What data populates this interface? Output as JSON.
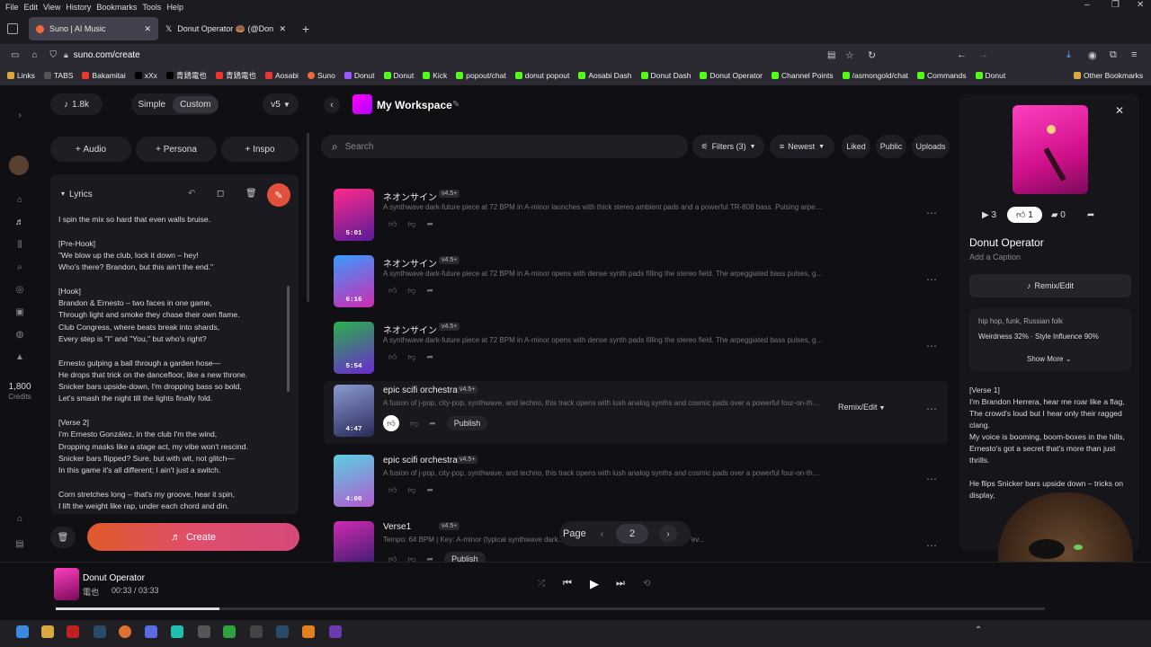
{
  "menubar": [
    "File",
    "Edit",
    "View",
    "History",
    "Bookmarks",
    "Tools",
    "Help"
  ],
  "tabs": [
    {
      "label": "Suno | AI Music",
      "active": true
    },
    {
      "label": "Donut Operator 🍩 (@DonutO…",
      "active": false
    }
  ],
  "url": "suno.com/create",
  "bookmarks": [
    "Links",
    "TABS",
    "Bakamitai",
    "xXx",
    "青鶏電也",
    "青鶏電也",
    "Aosabi",
    "Suno",
    "Donut",
    "Donut",
    "Kick",
    "popout/chat",
    "donut popout",
    "Aosabi Dash",
    "Donut Dash",
    "Donut Operator",
    "Channel Points",
    "/asmongold/chat",
    "Commands",
    "Donut"
  ],
  "other_bookmarks": "Other Bookmarks",
  "credits": {
    "value": "1,800",
    "label": "Credits"
  },
  "create": {
    "note_count": "1.8k",
    "mode_simple": "Simple",
    "mode_custom": "Custom",
    "version": "v5",
    "audio_btn": "Audio",
    "persona_btn": "Persona",
    "inspo_btn": "Inspo",
    "lyrics_label": "Lyrics",
    "lyrics_text": "I spin the mix so hard that even walls bruise.\n\n[Pre-Hook]\n\"We blow up the club, lock it down – hey!\nWho's there? Brandon, but this ain't the end.\"\n\n[Hook]\nBrandon & Ernesto – two faces in one game,\nThrough light and smoke they chase their own flame.\nClub Congress, where beats break into shards,\nEvery step is \"I\" and \"You,\" but who's right?\n\nErnesto gulping a ball through a garden hose—\nHe drops that trick on the dancefloor, like a new throne.\nSnicker bars upside-down, I'm dropping bass so bold,\nLet's smash the night till the lights finally fold.\n\n[Verse 2]\nI'm Ernesto González, in the club I'm the wind,\nDropping masks like a stage act, my vibe won't rescind.\nSnicker bars flipped? Sure, but with wit, not glitch—\nIn this game it's all different; I ain't just a switch.\n\nCorn stretches long – that's my groove, hear it spin,\nI lift the weight like rap, under each chord and din.",
    "create_btn": "Create"
  },
  "workspace": {
    "title": "My Workspace",
    "search_placeholder": "Search",
    "filters": "Filters (3)",
    "sort": "Newest",
    "liked": "Liked",
    "public": "Public",
    "uploads": "Uploads"
  },
  "songs": [
    {
      "title": "ネオンサイン",
      "version": "v4.5+",
      "desc": "A synthwave dark-future piece at 72 BPM in A-minor launches with thick stereo ambient pads and a powerful TR-808 bass. Pulsing arpeggiated...",
      "duration": "5:01",
      "colors": [
        "#ff2a8a",
        "#5a1a9a"
      ]
    },
    {
      "title": "ネオンサイン",
      "version": "v4.5+",
      "desc": "A synthwave dark-future piece at 72 BPM in A-minor opens with dense synth pads filling the stereo field. The arpeggiated bass pulses, giving for...",
      "duration": "6:16",
      "colors": [
        "#3a9aff",
        "#d02ab0"
      ]
    },
    {
      "title": "ネオンサイン",
      "version": "v4.5+",
      "desc": "A synthwave dark-future piece at 72 BPM in A-minor opens with dense synth pads filling the stereo field. The arpeggiated bass pulses, giving for...",
      "duration": "5:54",
      "colors": [
        "#2ab04a",
        "#6a2ad0"
      ]
    },
    {
      "title": "epic scifi orchestra",
      "version": "v4.5+",
      "desc": "A fusion of j-pop, city-pop, synthwave, and techno, this track opens with lush analog synths and cosmic pads over a powerful four-on-the-floor b...",
      "duration": "4:47",
      "colors": [
        "#8a9ad0",
        "#2a2a5a"
      ],
      "publish": "Publish",
      "remix": "Remix/Edit"
    },
    {
      "title": "epic scifi orchestra",
      "version": "v4.5+",
      "desc": "A fusion of j-pop, city-pop, synthwave, and techno, this track opens with lush analog synths and cosmic pads over a powerful four-on-the-floor b...",
      "duration": "4:00",
      "colors": [
        "#5ad0e0",
        "#b05ad0"
      ]
    },
    {
      "title": "Verse1",
      "version": "v4.5+",
      "desc": "Tempo: 64 BPM | Key: A-minor (typical synthwave dark... echoing leads. Let the music paint the \"ev...",
      "duration": "",
      "colors": [
        "#d02ab0",
        "#2a1a6a"
      ],
      "publish": "Publish"
    }
  ],
  "pager": {
    "label": "Page",
    "current": "2"
  },
  "detail": {
    "plays": "3",
    "likes": "1",
    "comments": "0",
    "title": "Donut Operator",
    "caption": "Add a Caption",
    "remix": "Remix/Edit",
    "tags": "hip hop, funk, Russian folk",
    "weirdness": "Weirdness 32% · Style Influence 90%",
    "show_more": "Show More",
    "lyrics": "[Verse 1]\nI'm Brandon Herrera, hear me roar like a flag,\nThe crowd's loud but I hear only their ragged clang.\nMy voice is booming, boom-boxes in the hills,\nErnesto's got a secret that's more than just thrills.\n\nHe flips Snicker bars upside down – tricks on display,"
  },
  "player": {
    "title": "Donut Operator",
    "artist": "電也",
    "time": "00:33 / 03:33",
    "progress": 0.165
  }
}
